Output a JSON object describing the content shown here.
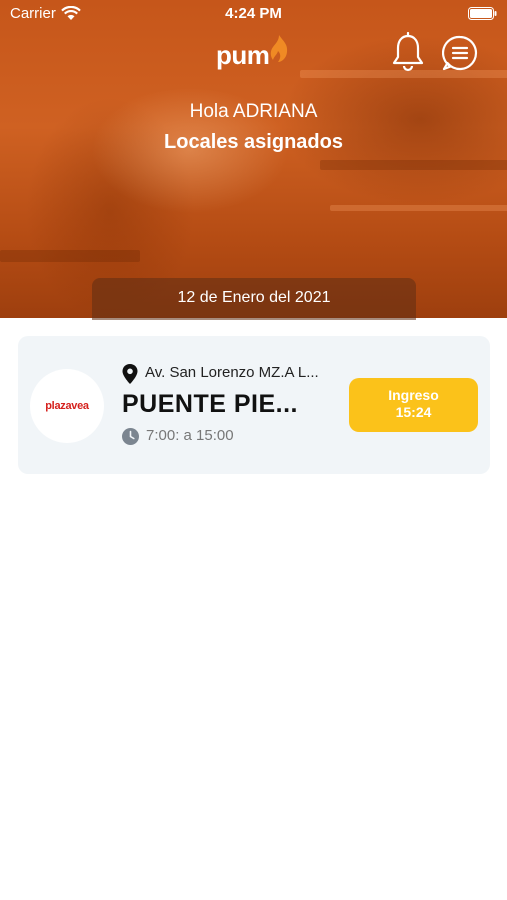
{
  "status_bar": {
    "carrier": "Carrier",
    "time": "4:24 PM"
  },
  "header": {
    "logo_text": "pum",
    "greeting": "Hola ADRIANA",
    "subtitle": "Locales asignados"
  },
  "date_label": "12 de Enero del 2021",
  "stores": [
    {
      "logo_text": "plazavea",
      "address": "Av. San Lorenzo MZ.A L...",
      "name": "PUENTE PIE...",
      "hours": "7:00: a 15:00",
      "checkin_label": "Ingreso",
      "checkin_time": "15:24"
    }
  ],
  "colors": {
    "brand_orange": "#cf6122",
    "button_yellow": "#fbc21a",
    "card_bg": "#f1f5f8",
    "logo_red": "#d5211d"
  },
  "icons": [
    "wifi-icon",
    "battery-icon",
    "flame-icon",
    "bell-icon",
    "menu-icon",
    "pin-icon",
    "clock-icon"
  ]
}
